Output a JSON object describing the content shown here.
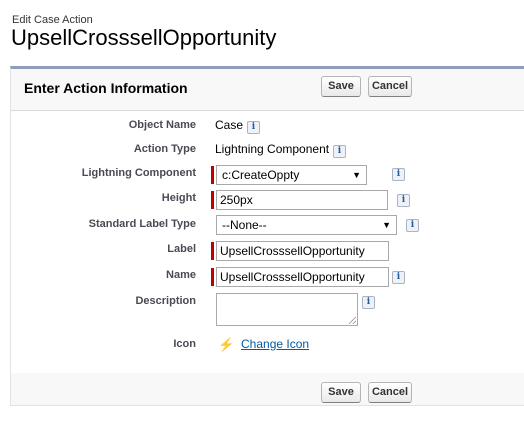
{
  "header": {
    "eyebrow": "Edit Case Action",
    "title": "UpsellCrosssellOpportunity"
  },
  "panel": {
    "title": "Enter Action Information",
    "save_label": "Save",
    "cancel_label": "Cancel"
  },
  "info_glyph": "i",
  "fields": {
    "object_name": {
      "label": "Object Name",
      "value": "Case"
    },
    "action_type": {
      "label": "Action Type",
      "value": "Lightning Component"
    },
    "lightning_component": {
      "label": "Lightning Component",
      "value": "c:CreateOppty"
    },
    "height": {
      "label": "Height",
      "value": "250px"
    },
    "standard_label_type": {
      "label": "Standard Label Type",
      "value": "--None--"
    },
    "label": {
      "label": "Label",
      "value": "UpsellCrosssellOpportunity"
    },
    "name": {
      "label": "Name",
      "value": "UpsellCrosssellOpportunity"
    },
    "description": {
      "label": "Description",
      "value": ""
    },
    "icon": {
      "label": "Icon",
      "icon": "lightning-bolt-icon",
      "link": "Change Icon"
    }
  },
  "colors": {
    "required": "#c00000",
    "panel_border_top": "#8e9dbe",
    "link": "#015ba7"
  }
}
